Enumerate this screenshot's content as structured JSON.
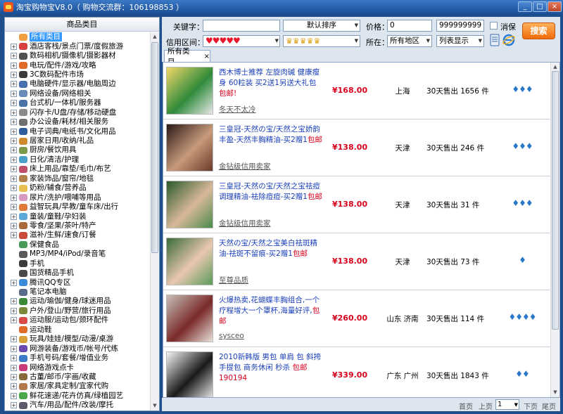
{
  "window": {
    "title": "淘宝购物宝V8.0（ 购物交流群：106198853 ）",
    "controls": [
      "_",
      "□",
      "×"
    ]
  },
  "sidebar": {
    "header": "商品类目",
    "items": [
      {
        "label": "所有类目",
        "expandable": false,
        "selected": true,
        "icon_color": "#f0a040"
      },
      {
        "label": "酒店客栈/景点门票/度假旅游",
        "expandable": true,
        "icon_color": "#d84040"
      },
      {
        "label": "数码相机/摄像机/摄影器材",
        "expandable": true,
        "icon_color": "#505050"
      },
      {
        "label": "电玩/配件/游戏/攻略",
        "expandable": true,
        "icon_color": "#e06a2a"
      },
      {
        "label": "3C数码配件市场",
        "expandable": true,
        "icon_color": "#3a3a3a"
      },
      {
        "label": "电脑硬件/显示器/电脑周边",
        "expandable": true,
        "icon_color": "#4a6fb0"
      },
      {
        "label": "网络设备/网络相关",
        "expandable": true,
        "icon_color": "#6a8ab8"
      },
      {
        "label": "台式机/一体机/服务器",
        "expandable": true,
        "icon_color": "#4a72a8"
      },
      {
        "label": "闪存卡/U盘/存储/移动硬盘",
        "expandable": true,
        "icon_color": "#8a8a8a"
      },
      {
        "label": "办公设备/耗材/相关服务",
        "expandable": true,
        "icon_color": "#6f6f6f"
      },
      {
        "label": "电子词典/电纸书/文化用品",
        "expandable": true,
        "icon_color": "#2e5c9c"
      },
      {
        "label": "居家日用/收纳/礼品",
        "expandable": true,
        "icon_color": "#cf8a2e"
      },
      {
        "label": "厨房/餐饮用具",
        "expandable": true,
        "icon_color": "#7a9a4a"
      },
      {
        "label": "日化/清洁/护理",
        "expandable": true,
        "icon_color": "#4aa0c8"
      },
      {
        "label": "床上用品/靠垫/毛巾/布艺",
        "expandable": true,
        "icon_color": "#c0506a"
      },
      {
        "label": "家装饰品/窗帘/地毯",
        "expandable": true,
        "icon_color": "#b0804a"
      },
      {
        "label": "奶粉/辅食/营养品",
        "expandable": true,
        "icon_color": "#e8c050"
      },
      {
        "label": "尿片/洗护/喂哺等用品",
        "expandable": true,
        "icon_color": "#d89ac0"
      },
      {
        "label": "益智玩具/早教/童车床/出行",
        "expandable": true,
        "icon_color": "#e07a3a"
      },
      {
        "label": "童装/童鞋/孕妇装",
        "expandable": true,
        "icon_color": "#5aa8d8"
      },
      {
        "label": "零食/坚果/茶叶/特产",
        "expandable": true,
        "icon_color": "#a86a3a"
      },
      {
        "label": "滋补/生鲜/速食/订餐",
        "expandable": true,
        "icon_color": "#c84a3a"
      },
      {
        "label": "保健食品",
        "expandable": false,
        "icon_color": "#4a9a5a"
      },
      {
        "label": "MP3/MP4/iPod/录音笔",
        "expandable": false,
        "icon_color": "#5a5a5a"
      },
      {
        "label": "手机",
        "expandable": false,
        "icon_color": "#3a3a3a"
      },
      {
        "label": "国货精品手机",
        "expandable": false,
        "icon_color": "#4a4a4a"
      },
      {
        "label": "腾讯QQ专区",
        "expandable": true,
        "icon_color": "#3a8ad8"
      },
      {
        "label": "笔记本电脑",
        "expandable": false,
        "icon_color": "#5a6a8a"
      },
      {
        "label": "运动/瑜伽/健身/球迷用品",
        "expandable": true,
        "icon_color": "#3a8a3a"
      },
      {
        "label": "户外/登山/野营/旅行用品",
        "expandable": true,
        "icon_color": "#7a8a3a"
      },
      {
        "label": "运动服/运动包/颈环配件",
        "expandable": true,
        "icon_color": "#d84a4a"
      },
      {
        "label": "运动鞋",
        "expandable": false,
        "icon_color": "#e06a2a"
      },
      {
        "label": "玩具/娃娃/模型/动漫/桌游",
        "expandable": true,
        "icon_color": "#d8a03a"
      },
      {
        "label": "网游装备/游戏币/帐号/代练",
        "expandable": true,
        "icon_color": "#6a4ab0"
      },
      {
        "label": "手机号码/套餐/增值业务",
        "expandable": true,
        "icon_color": "#3a7ac8"
      },
      {
        "label": "网络游戏点卡",
        "expandable": true,
        "icon_color": "#c83a7a"
      },
      {
        "label": "古董/邮币/字画/收藏",
        "expandable": true,
        "icon_color": "#8a6a3a"
      },
      {
        "label": "家居/家具定制/宜家代购",
        "expandable": true,
        "icon_color": "#b07a4a"
      },
      {
        "label": "鲜花速递/花卉仿真/绿植园艺",
        "expandable": true,
        "icon_color": "#4aa84a"
      },
      {
        "label": "汽车/用品/配件/改装/摩托",
        "expandable": true,
        "icon_color": "#5a5a6a"
      }
    ]
  },
  "toolbar": {
    "keyword_label": "关键字：",
    "keyword_value": "",
    "sort_value": "默认排序",
    "price_label": "价格：",
    "price_min": "0",
    "price_max": "999999999",
    "consumer_protect_label": "消保",
    "credit_label": "信用区间：",
    "credit_from": "♥♥♥♥♥",
    "credit_to": "♛♛♛♛♛",
    "location_label": "所在：",
    "location_value": "所有地区",
    "view_value": "列表显示",
    "search_label": "搜索"
  },
  "tabs": [
    {
      "label": "所有类目",
      "close": "×"
    }
  ],
  "products": [
    {
      "title": "西木博士推荐 左旋肉碱 健康瘦身 60粒装 买2送1另送大礼包 ",
      "tag": "包邮!",
      "shop": "冬天不太冷",
      "price": "¥168.00",
      "location": "上海",
      "sales": "30天售出 1656 件",
      "level": "♦♦♦",
      "thumb_colors": [
        "#f3d86a",
        "#2e8a3a",
        "#e8e8e8"
      ]
    },
    {
      "title": "三皇冠-天然の宝/天然之宝娇韵丰盈-天然丰胸精油-买2赠1",
      "tag": "包邮",
      "shop": "金钻级信用卖家",
      "price": "¥138.00",
      "location": "天津",
      "sales": "30天售出 246 件",
      "level": "♦♦♦",
      "thumb_colors": [
        "#2a1a18",
        "#c89a7a",
        "#6a3a2a"
      ]
    },
    {
      "title": "三皇冠-天然の宝/天然之宝祛痘调理精油-祛除痘痘-买2赠1",
      "tag": "包邮",
      "shop": "金钻级信用卖家",
      "price": "¥138.00",
      "location": "天津",
      "sales": "30天售出 31 件",
      "level": "♦♦♦",
      "thumb_colors": [
        "#2a5a2a",
        "#d8b89a",
        "#4a8a4a"
      ]
    },
    {
      "title": "天然の宝/天然之宝美白祛斑精油-祛斑不留痕-买2赠1",
      "tag": "包邮",
      "shop": "至尊品质",
      "price": "¥138.00",
      "location": "天津",
      "sales": "30天售出 73 件",
      "level": "♦",
      "thumb_colors": [
        "#3a6a3a",
        "#e8c8b0",
        "#5a9a5a"
      ]
    },
    {
      "title": "火爆热卖,花蝴蝶丰胸组合,一个疗程增大一个罩杯,海量好评,",
      "tag": "包邮",
      "shop": "sysceo",
      "price": "¥260.00",
      "location": "山东 济南",
      "sales": "30天售出 114 件",
      "level": "♦♦♦♦",
      "thumb_colors": [
        "#c8c0b8",
        "#7a2a2a",
        "#e8e0d8"
      ]
    },
    {
      "title": "2010新韩版 男包 单肩 包 斜挎 手提包 商务休闲 秒杀 ",
      "tag": "包邮190194",
      "shop": "",
      "price": "¥339.00",
      "location": "广东 广州",
      "sales": "30天售出 1843 件",
      "level": "♦♦",
      "thumb_colors": [
        "#f4f4f4",
        "#1a1a1a",
        "#e8e8e8"
      ]
    }
  ],
  "pager": {
    "first": "首页",
    "prev": "上页",
    "page": "1",
    "next": "下页",
    "last": "尾页"
  }
}
